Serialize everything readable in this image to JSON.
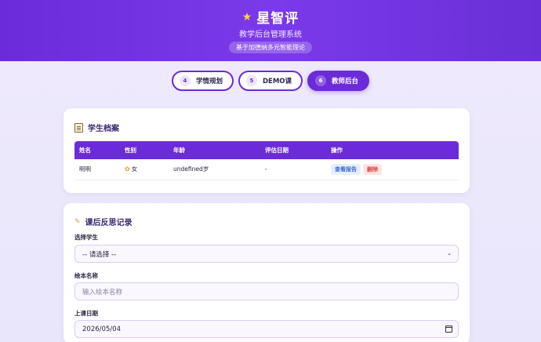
{
  "header": {
    "title": "星智评",
    "subtitle": "教学后台管理系统",
    "tagline": "基于加德纳多元智能理论",
    "icon": "star-icon"
  },
  "tabs": [
    {
      "num": "4",
      "label": "学情规划",
      "active": false
    },
    {
      "num": "5",
      "label": "DEMO课",
      "active": false
    },
    {
      "num": "6",
      "label": "教师后台",
      "active": true
    }
  ],
  "profiles": {
    "title": "学生档案",
    "icon": "document-icon",
    "columns": [
      "姓名",
      "性别",
      "年龄",
      "评估日期",
      "操作"
    ],
    "rows": [
      {
        "name": "明明",
        "gender": "女",
        "age": "undefined岁",
        "date": "-",
        "report_label": "查看报告",
        "delete_label": "删除"
      }
    ]
  },
  "reflection": {
    "title": "课后反思记录",
    "icon": "memo-icon",
    "student_label": "选择学生",
    "student_value": "-- 请选择 --",
    "book_label": "绘本名称",
    "book_placeholder": "输入绘本名称",
    "date_label": "上课日期",
    "date_value": "2026/05/04"
  },
  "colors": {
    "accent": "#6c2bd9",
    "report": "#3b6ad6",
    "delete": "#d84040"
  }
}
